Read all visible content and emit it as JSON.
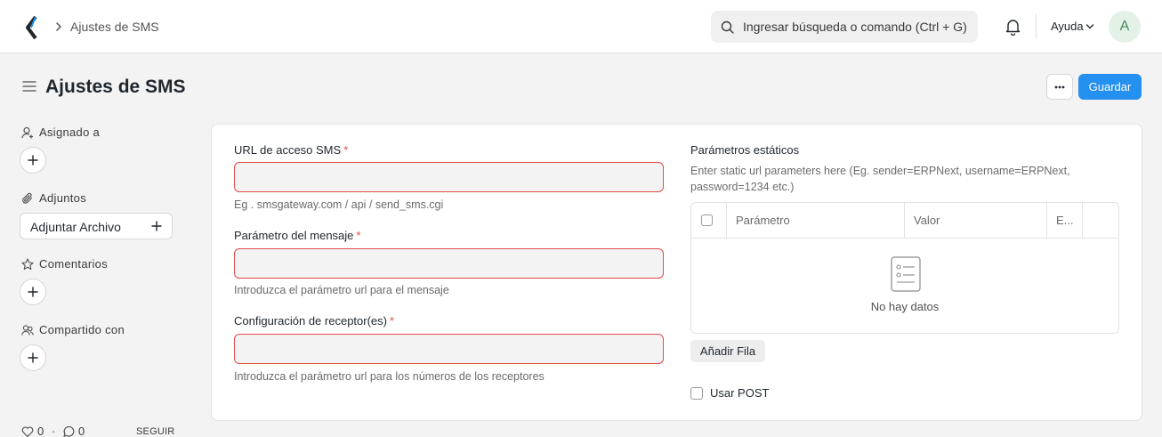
{
  "navbar": {
    "breadcrumb": "Ajustes de SMS",
    "search_placeholder": "Ingresar búsqueda o comando (Ctrl + G)",
    "help_label": "Ayuda",
    "avatar_initial": "A"
  },
  "page": {
    "title": "Ajustes de SMS",
    "more_label": "...",
    "save_label": "Guardar"
  },
  "sidebar": {
    "assigned_label": "Asignado a",
    "attachments_label": "Adjuntos",
    "attach_button": "Adjuntar Archivo",
    "comments_label": "Comentarios",
    "shared_label": "Compartido con",
    "likes_count": "0",
    "comments_count": "0",
    "follow_label": "SEGUIR"
  },
  "form": {
    "url_label": "URL de acceso SMS",
    "url_value": "",
    "url_desc": "Eg . smsgateway.com / api / send_sms.cgi",
    "msg_param_label": "Parámetro del mensaje",
    "msg_param_value": "",
    "msg_param_desc": "Introduzca el parámetro url para el mensaje",
    "receiver_label": "Configuración de receptor(es)",
    "receiver_value": "",
    "receiver_desc": "Introduzca el parámetro url para los números de los receptores",
    "required_mark": "*",
    "static_params_label": "Parámetros estáticos",
    "static_params_desc": "Enter static url parameters here (Eg. sender=ERPNext, username=ERPNext, password=1234 etc.)",
    "grid": {
      "columns": [
        "Parámetro",
        "Valor",
        "E..."
      ],
      "empty_text": "No hay datos"
    },
    "add_row_label": "Añadir Fila",
    "use_post_label": "Usar POST",
    "use_post_checked": false
  },
  "colors": {
    "primary": "#2490ef",
    "required": "#e24c4c",
    "background": "#f3f3f3"
  }
}
